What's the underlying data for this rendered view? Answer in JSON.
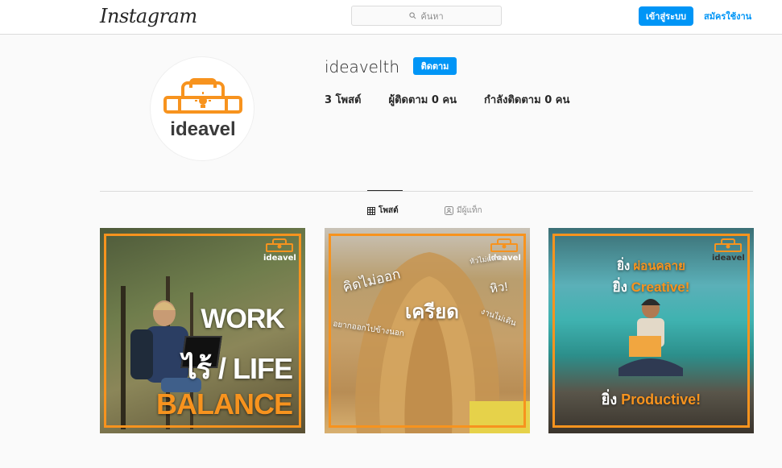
{
  "header": {
    "logo": "Instagram",
    "search_placeholder": "ค้นหา",
    "login_label": "เข้าสู่ระบบ",
    "signup_label": "สมัครใช้งาน"
  },
  "profile": {
    "avatar_text": "ideavel",
    "username": "ideavelth",
    "follow_label": "ติดตาม",
    "stats": {
      "posts": "3 โพสต์",
      "followers": "ผู้ติดตาม 0 คน",
      "following": "กำลังติดตาม 0 คน"
    }
  },
  "tabs": {
    "posts": "โพสต์",
    "tagged": "มีผู้แท็ก"
  },
  "posts": [
    {
      "logo": "ideavel",
      "line1": "WORK",
      "line2": "ไร้ / LIFE",
      "line3": "BALANCE"
    },
    {
      "logo": "ideavel",
      "think": "คิดไม่ออก",
      "stress": "เครียด",
      "hungry": "หิว!",
      "head": "หัวไม่แล่น",
      "work": "งานไม่เดิน",
      "out": "อยากออกไปข้างนอก"
    },
    {
      "logo": "ideavel",
      "line1_a": "ยิ่ง",
      "line1_b": "ผ่อนคลาย",
      "line2_a": "ยิ่ง",
      "line2_b": "Creative!",
      "line3_a": "ยิ่ง",
      "line3_b": "Productive!"
    }
  ],
  "colors": {
    "brand_orange": "#f7931e",
    "primary_blue": "#0095f6"
  }
}
